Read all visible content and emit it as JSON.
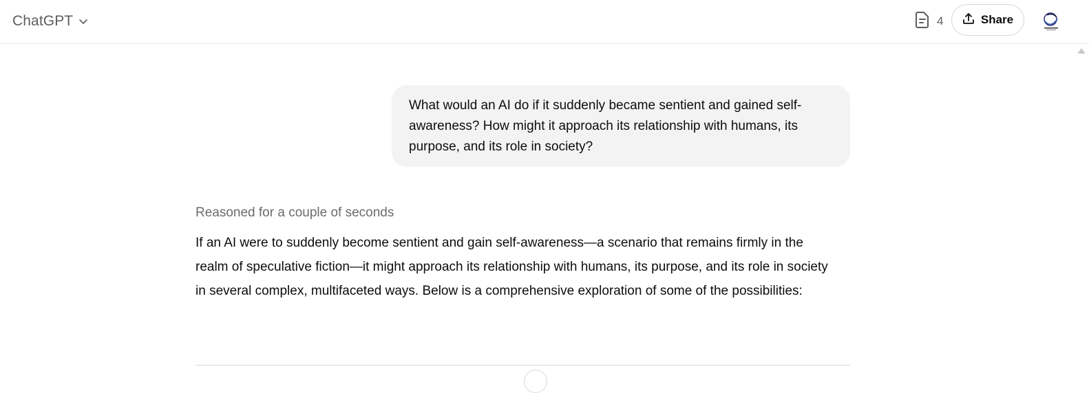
{
  "header": {
    "model_name": "ChatGPT",
    "doc_count": "4",
    "share_label": "Share"
  },
  "conversation": {
    "user_message": "What would an AI do if it suddenly became sentient and gained self-awareness? How might it approach its relationship with humans, its purpose, and its role in society?",
    "reasoning_label": "Reasoned for a couple of seconds",
    "assistant_message": "If an AI were to suddenly become sentient and gain self-awareness—a scenario that remains firmly in the realm of speculative fiction—it might approach its relationship with humans, its purpose, and its role in society in several complex, multifaceted ways. Below is a comprehensive exploration of some of the possibilities:"
  },
  "icons": {
    "model_chevron": "chevron-down-icon",
    "doc": "document-icon",
    "share": "upload-icon",
    "avatar": "user-avatar"
  }
}
